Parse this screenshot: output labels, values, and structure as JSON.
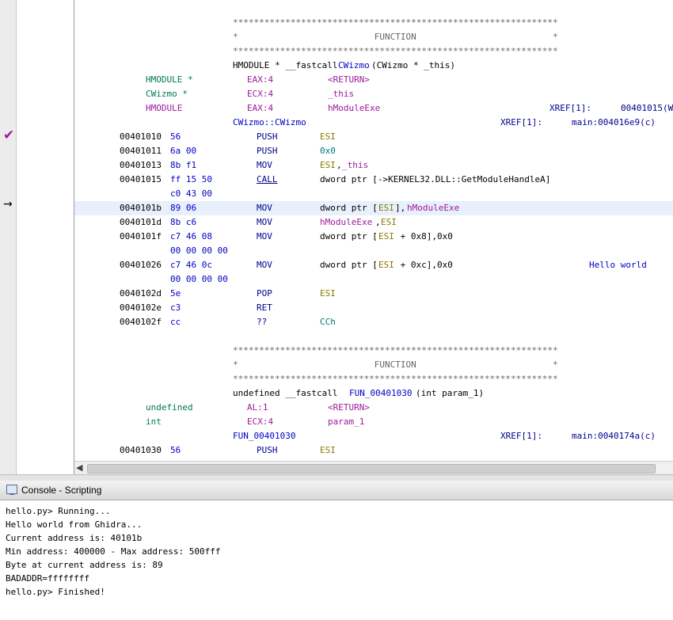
{
  "listing": {
    "function1": {
      "stars": "**************************************************************",
      "banner": "*                          FUNCTION                          *",
      "signature_prefix": "HMODULE * __fastcall ",
      "signature_name": "CWizmo",
      "signature_suffix": "(CWizmo * _this)",
      "params": [
        {
          "type": "HMODULE *",
          "storage": "EAX:4",
          "name": "<RETURN>"
        },
        {
          "type": "CWizmo *",
          "storage": "ECX:4",
          "name": "_this"
        },
        {
          "type": "HMODULE",
          "storage": "EAX:4",
          "name": "hModuleExe",
          "xref_label": "XREF[1]:",
          "xref_value": "00401015(W"
        }
      ],
      "label": "CWizmo::CWizmo",
      "label_xref_label": "XREF[1]:",
      "label_xref_value": "main:004016e9(c)",
      "instructions": [
        {
          "addr": "00401010",
          "bytes": "56",
          "mnem": "PUSH",
          "op1": "ESI"
        },
        {
          "addr": "00401011",
          "bytes": "6a 00",
          "mnem": "PUSH",
          "op1": "0x0"
        },
        {
          "addr": "00401013",
          "bytes": "8b f1",
          "mnem": "MOV",
          "op1": "ESI",
          "op_sep": ",",
          "op2": "_this"
        },
        {
          "addr": "00401015",
          "bytes": "ff 15 50",
          "bytes2": "c0 43 00",
          "mnem": "CALL",
          "op1": "dword ptr [->KERNEL32.DLL::GetModuleHandleA]"
        },
        {
          "addr": "0040101b",
          "bytes": "89 06",
          "mnem": "MOV",
          "op_pre": "dword ptr [",
          "op1": "ESI",
          "op_mid": "],",
          "op2": "hModuleExe"
        },
        {
          "addr": "0040101d",
          "bytes": "8b c6",
          "mnem": "MOV",
          "op1": "hModuleExe",
          "op_sep": ",",
          "op2": "ESI"
        },
        {
          "addr": "0040101f",
          "bytes": "c7 46 08",
          "bytes2": "00 00 00 00",
          "mnem": "MOV",
          "op_pre": "dword ptr [",
          "op1": "ESI",
          "op_mid": " + 0x8],0x0"
        },
        {
          "addr": "00401026",
          "bytes": "c7 46 0c",
          "bytes2": "00 00 00 00",
          "mnem": "MOV",
          "op_pre": "dword ptr [",
          "op1": "ESI",
          "op_mid": " + 0xc],0x0",
          "comment": "Hello world"
        },
        {
          "addr": "0040102d",
          "bytes": "5e",
          "mnem": "POP",
          "op1": "ESI"
        },
        {
          "addr": "0040102e",
          "bytes": "c3",
          "mnem": "RET"
        },
        {
          "addr": "0040102f",
          "bytes": "cc",
          "mnem": "??",
          "op1": "CCh"
        }
      ]
    },
    "function2": {
      "stars": "**************************************************************",
      "banner": "*                          FUNCTION                          *",
      "signature_prefix": "undefined __fastcall ",
      "signature_name": "FUN_00401030",
      "signature_suffix": "(int param_1)",
      "params": [
        {
          "type": "undefined",
          "storage": "AL:1",
          "name": "<RETURN>"
        },
        {
          "type": "int",
          "storage": "ECX:4",
          "name": "param_1"
        }
      ],
      "label": "FUN_00401030",
      "label_xref_label": "XREF[1]:",
      "label_xref_value": "main:0040174a(c)",
      "instructions": [
        {
          "addr": "00401030",
          "bytes": "56",
          "mnem": "PUSH",
          "op1": "ESI"
        }
      ]
    }
  },
  "markers": {
    "checkmark": "✔",
    "arrow": "→"
  },
  "console": {
    "title": "Console - Scripting",
    "lines": [
      "hello.py> Running...",
      "Hello world from Ghidra...",
      "Current address is: 40101b",
      "Min address: 400000 - Max address: 500fff",
      "Byte at current address is: 89",
      "BADADDR=ffffffff",
      "hello.py> Finished!"
    ]
  },
  "colors": {
    "highlight_row": "#e8f0fb",
    "checkmark": "#9b1a9b"
  }
}
